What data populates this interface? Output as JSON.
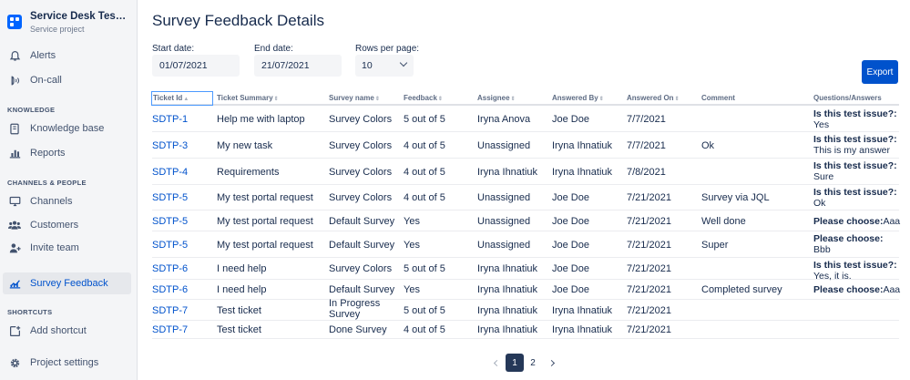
{
  "project": {
    "name": "Service Desk Test Pro...",
    "type": "Service project"
  },
  "sidebar": {
    "top_items": [
      {
        "label": "Alerts",
        "icon": "bell-icon"
      },
      {
        "label": "On-call",
        "icon": "phone-icon"
      }
    ],
    "sections": {
      "knowledge": "KNOWLEDGE",
      "channels": "CHANNELS & PEOPLE",
      "shortcuts": "SHORTCUTS"
    },
    "knowledge_items": [
      {
        "label": "Knowledge base",
        "icon": "book-icon"
      },
      {
        "label": "Reports",
        "icon": "bar-chart-icon"
      }
    ],
    "channel_items": [
      {
        "label": "Channels",
        "icon": "monitor-icon"
      },
      {
        "label": "Customers",
        "icon": "people-icon"
      },
      {
        "label": "Invite team",
        "icon": "add-person-icon"
      }
    ],
    "active_item": {
      "label": "Survey Feedback",
      "icon": "chart-line-icon"
    },
    "add_shortcut": "Add shortcut",
    "project_settings": "Project settings"
  },
  "page": {
    "title": "Survey Feedback Details"
  },
  "filters": {
    "start_label": "Start date:",
    "start_value": "01/07/2021",
    "end_label": "End date:",
    "end_value": "21/07/2021",
    "rows_label": "Rows per page:",
    "rows_value": "10"
  },
  "export_label": "Export",
  "table": {
    "headers": [
      "Ticket Id",
      "Ticket Summary",
      "Survey name",
      "Feedback",
      "Assignee",
      "Answered By",
      "Answered On",
      "Comment",
      "Questions/Answers"
    ],
    "rows": [
      {
        "id": "SDTP-1",
        "summary": "Help me with laptop",
        "survey": "Survey Colors",
        "feedback": "5 out of 5",
        "assignee": "Iryna Anova",
        "answered_by": "Joe Doe",
        "answered_on": "7/7/2021",
        "comment": "",
        "question": "Is this test issue?:",
        "answer": "Yes"
      },
      {
        "id": "SDTP-3",
        "summary": "My new task",
        "survey": "Survey Colors",
        "feedback": "4 out of 5",
        "assignee": "Unassigned",
        "answered_by": "Iryna Ihnatiuk",
        "answered_on": "7/7/2021",
        "comment": "Ok",
        "question": "Is this test issue?:",
        "answer": "This is my answer"
      },
      {
        "id": "SDTP-4",
        "summary": "Requirements",
        "survey": "Survey Colors",
        "feedback": "4 out of 5",
        "assignee": "Iryna Ihnatiuk",
        "answered_by": "Iryna Ihnatiuk",
        "answered_on": "7/8/2021",
        "comment": "",
        "question": "Is this test issue?:",
        "answer": "Sure"
      },
      {
        "id": "SDTP-5",
        "summary": "My test portal request",
        "survey": "Survey Colors",
        "feedback": "4 out of 5",
        "assignee": "Unassigned",
        "answered_by": "Joe Doe",
        "answered_on": "7/21/2021",
        "comment": "Survey via JQL",
        "question": "Is this test issue?:",
        "answer": "Ok"
      },
      {
        "id": "SDTP-5",
        "summary": "My test portal request",
        "survey": "Default Survey",
        "feedback": "Yes",
        "assignee": "Unassigned",
        "answered_by": "Joe Doe",
        "answered_on": "7/21/2021",
        "comment": "Well done",
        "question": "Please choose:",
        "answer": "Aaa"
      },
      {
        "id": "SDTP-5",
        "summary": "My test portal request",
        "survey": "Default Survey",
        "feedback": "Yes",
        "assignee": "Unassigned",
        "answered_by": "Joe Doe",
        "answered_on": "7/21/2021",
        "comment": "Super",
        "question": "Please choose:",
        "answer": "Bbb"
      },
      {
        "id": "SDTP-6",
        "summary": "I need help",
        "survey": "Survey Colors",
        "feedback": "5 out of 5",
        "assignee": "Iryna Ihnatiuk",
        "answered_by": "Joe Doe",
        "answered_on": "7/21/2021",
        "comment": "",
        "question": "Is this test issue?:",
        "answer": "Yes, it is."
      },
      {
        "id": "SDTP-6",
        "summary": "I need help",
        "survey": "Default Survey",
        "feedback": "Yes",
        "assignee": "Iryna Ihnatiuk",
        "answered_by": "Joe Doe",
        "answered_on": "7/21/2021",
        "comment": "Completed survey",
        "question": "Please choose:",
        "answer": "Aaa"
      },
      {
        "id": "SDTP-7",
        "summary": "Test ticket",
        "survey": "In Progress Survey",
        "feedback": "5 out of 5",
        "assignee": "Iryna Ihnatiuk",
        "answered_by": "Iryna Ihnatiuk",
        "answered_on": "7/21/2021",
        "comment": "",
        "question": "",
        "answer": ""
      },
      {
        "id": "SDTP-7",
        "summary": "Test ticket",
        "survey": "Done Survey",
        "feedback": "4 out of 5",
        "assignee": "Iryna Ihnatiuk",
        "answered_by": "Iryna Ihnatiuk",
        "answered_on": "7/21/2021",
        "comment": "",
        "question": "",
        "answer": ""
      }
    ]
  },
  "pagination": {
    "pages": [
      "1",
      "2"
    ],
    "current": "1"
  }
}
